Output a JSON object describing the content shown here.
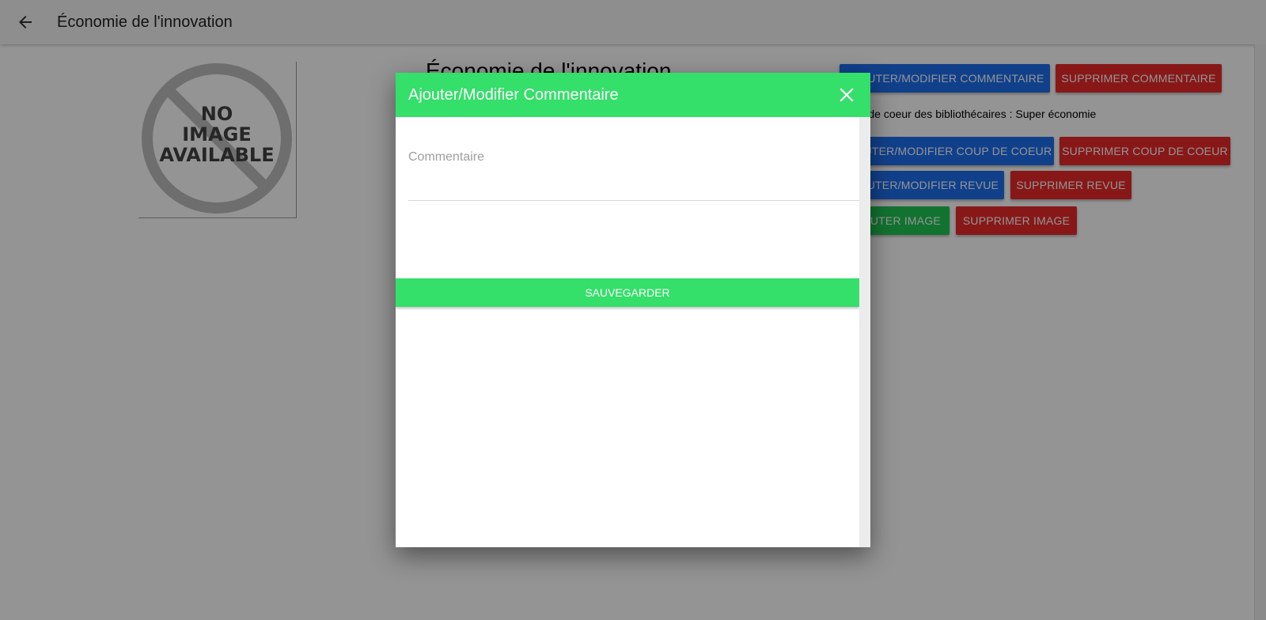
{
  "appbar": {
    "title": "Économie de l'innovation"
  },
  "page": {
    "no_image_text": [
      "NO",
      "IMAGE",
      "AVAILABLE"
    ],
    "book_title": "Économie de l'innovation",
    "favorite_text": "Coup de coeur des bibliothécaires : Super économie"
  },
  "actions": {
    "add_comment": "Ajouter/Modifier commentaire",
    "delete_comment": "Supprimer commentaire",
    "add_favorite": "Ajouter/Modifier coup de coeur",
    "delete_favorite": "Supprimer coup de coeur",
    "add_review": "Ajouter/Modifier revue",
    "delete_review": "Supprimer revue",
    "add_image": "Ajouter image",
    "delete_image": "Supprimer image"
  },
  "dialog": {
    "title": "Ajouter/Modifier Commentaire",
    "field_label": "Commentaire",
    "field_value": "",
    "save_label": "Sauvegarder"
  },
  "colors": {
    "primary_green": "#34df6a",
    "action_blue": "#1e6ff0",
    "action_red": "#ea2a2a",
    "action_green": "#1fc653",
    "overlay": "rgba(0,0,0,0.42)"
  },
  "icons": {
    "back": "arrow-left-icon",
    "close": "close-icon",
    "placeholder": "no-image-icon"
  }
}
